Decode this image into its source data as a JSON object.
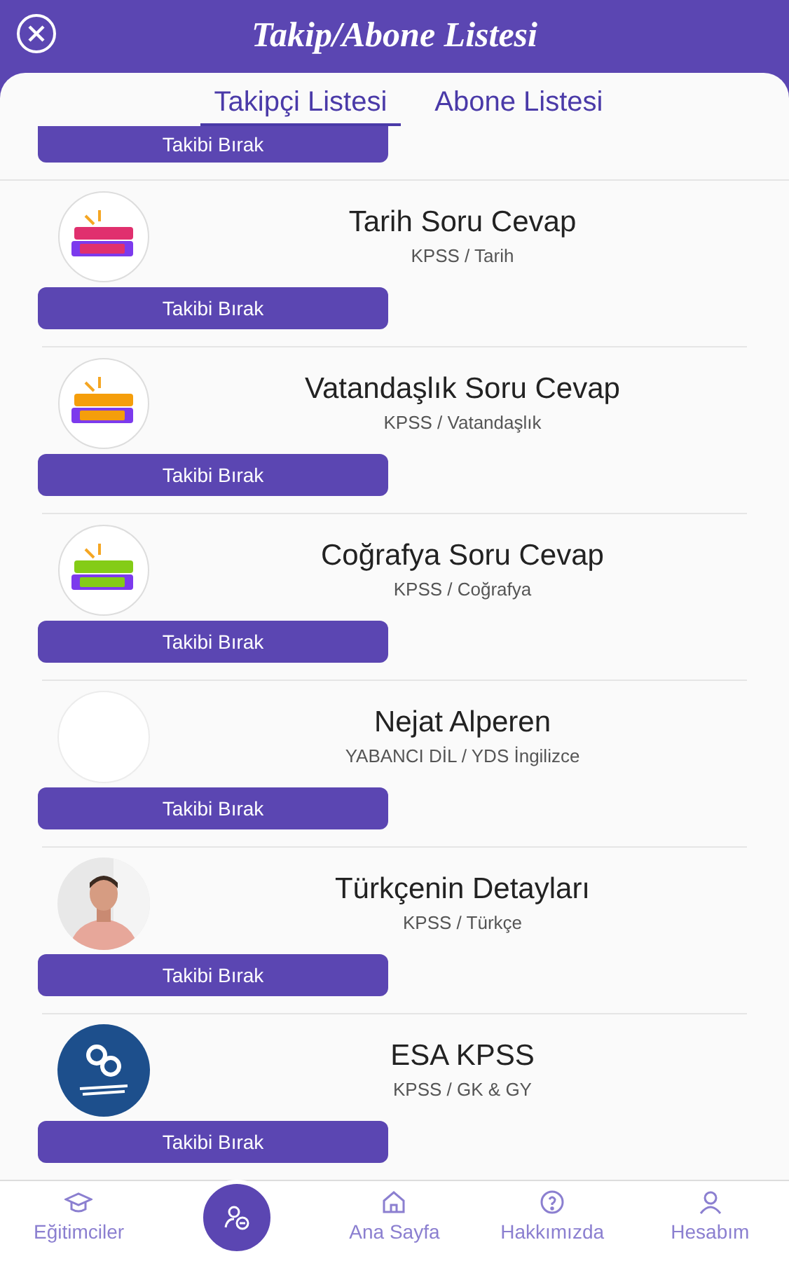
{
  "header": {
    "title": "Takip/Abone Listesi"
  },
  "tabs": [
    {
      "label": "Takipçi Listesi",
      "selected": true
    },
    {
      "label": "Abone Listesi",
      "selected": false
    }
  ],
  "partial_item": {
    "button": "Takibi Bırak"
  },
  "items": [
    {
      "name": "Tarih Soru Cevap",
      "subtitle": "KPSS / Tarih",
      "kind": "badge",
      "color": "#e0306e",
      "button": "Takibi Bırak"
    },
    {
      "name": "Vatandaşlık Soru Cevap",
      "subtitle": "KPSS / Vatandaşlık",
      "kind": "badge",
      "color": "#f59e0b",
      "button": "Takibi Bırak"
    },
    {
      "name": "Coğrafya Soru Cevap",
      "subtitle": "KPSS / Coğrafya",
      "kind": "badge",
      "color": "#84cc16",
      "button": "Takibi Bırak"
    },
    {
      "name": "Nejat Alperen",
      "subtitle": "YABANCI DİL / YDS İngilizce",
      "kind": "blank",
      "button": "Takibi Bırak"
    },
    {
      "name": "Türkçenin Detayları",
      "subtitle": "KPSS / Türkçe",
      "button": "Takibi Bırak"
    },
    {
      "name": "ESA KPSS",
      "subtitle": "KPSS / GK & GY",
      "kind": "emblem",
      "button": "Takibi Bırak"
    }
  ],
  "nav": [
    {
      "kind": "educators",
      "label": "Eğitimciler"
    },
    {
      "kind": "fab"
    },
    {
      "kind": "home",
      "label": "Ana Sayfa"
    },
    {
      "kind": "about",
      "label": "Hakkımızda"
    },
    {
      "kind": "account",
      "label": "Hesabım"
    }
  ]
}
